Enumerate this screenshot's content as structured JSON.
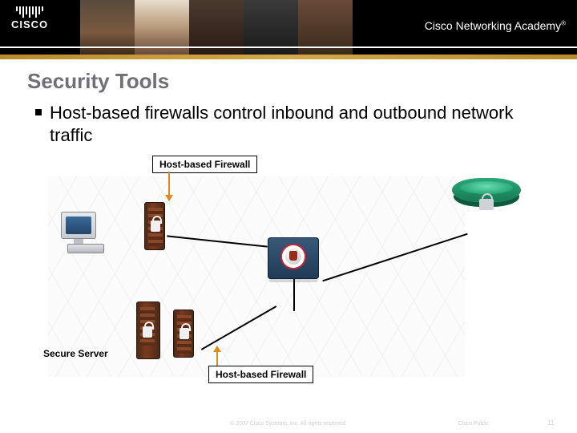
{
  "header": {
    "brand": "CISCO",
    "academy": "Cisco Networking Academy",
    "trademark": "®"
  },
  "title": "Security Tools",
  "bullet": "Host-based firewalls control inbound and outbound network traffic",
  "diagram": {
    "label_host_fw_top": "Host-based Firewall",
    "label_host_fw_bottom": "Host-based Firewall",
    "label_secure_server": "Secure Server"
  },
  "footer": {
    "copyright": "© 2007 Cisco Systems, Inc. All rights reserved.",
    "classification": "Cisco Public",
    "page": "11"
  }
}
